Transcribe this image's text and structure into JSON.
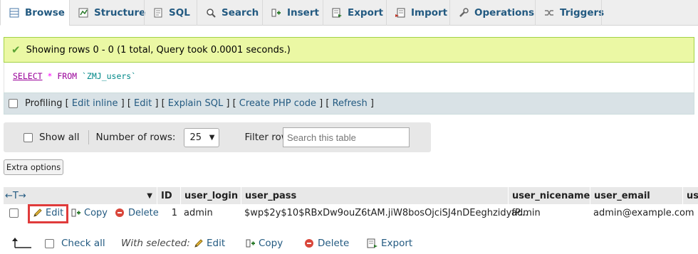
{
  "tabs": [
    {
      "label": "Browse",
      "icon": "browse-icon"
    },
    {
      "label": "Structure",
      "icon": "structure-icon"
    },
    {
      "label": "SQL",
      "icon": "sql-icon"
    },
    {
      "label": "Search",
      "icon": "search-icon"
    },
    {
      "label": "Insert",
      "icon": "insert-icon"
    },
    {
      "label": "Export",
      "icon": "export-icon"
    },
    {
      "label": "Import",
      "icon": "import-icon"
    },
    {
      "label": "Operations",
      "icon": "operations-icon"
    },
    {
      "label": "Triggers",
      "icon": "triggers-icon"
    }
  ],
  "message": {
    "text": "Showing rows 0 - 0 (1 total, Query took 0.0001 seconds.)",
    "color": "#ebf8a4"
  },
  "sql": {
    "select": "SELECT",
    "star": "*",
    "from": "FROM",
    "table": "`ZMJ_users`"
  },
  "profiling": {
    "label": "Profiling",
    "links": [
      "Edit inline",
      "Edit",
      "Explain SQL",
      "Create PHP code",
      "Refresh"
    ]
  },
  "nav": {
    "show_all": "Show all",
    "rows_label": "Number of rows:",
    "rows_value": "25",
    "filter_label": "Filter rows:",
    "filter_placeholder": "Search this table"
  },
  "extra_options": "Extra options",
  "table": {
    "arrows": "←T→",
    "headers": [
      "ID",
      "user_login",
      "user_pass",
      "user_nicename",
      "user_email",
      "us"
    ],
    "row": {
      "edit": "Edit",
      "copy": "Copy",
      "delete": "Delete",
      "id": "1",
      "user_login": "admin",
      "user_pass": "$wp$2y$10$RBxDw9ouZ6tAM.jiW8bosOjciSJ4nDEeghzidyfP...",
      "user_nicename": "admin",
      "user_email": "admin@example.com"
    }
  },
  "bottom": {
    "check_all": "Check all",
    "with_selected": "With selected:",
    "edit": "Edit",
    "copy": "Copy",
    "delete": "Delete",
    "export": "Export"
  },
  "colors": {
    "link": "#235a81",
    "highlight_border": "#e03b3b",
    "profiling_bg": "#d9e2e6"
  }
}
